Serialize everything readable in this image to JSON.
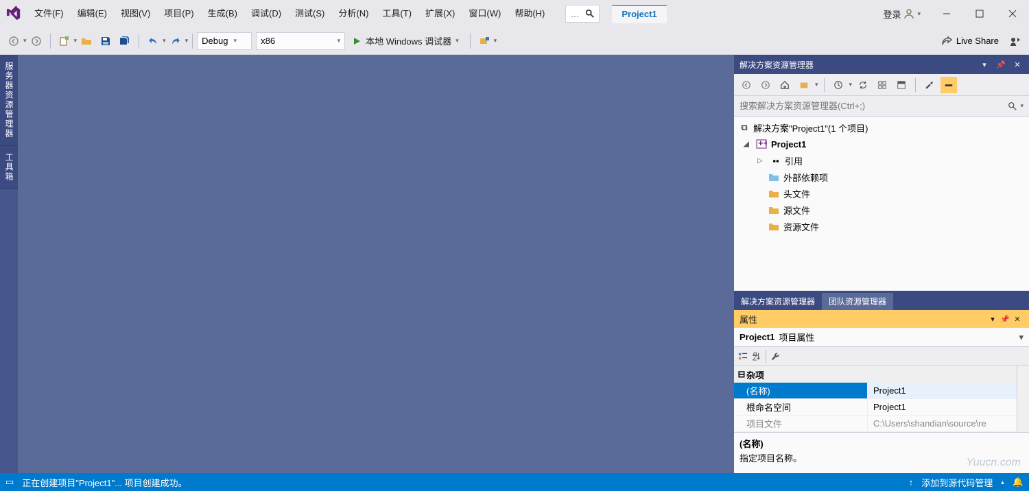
{
  "menu": {
    "file": "文件(F)",
    "edit": "编辑(E)",
    "view": "视图(V)",
    "project": "项目(P)",
    "build": "生成(B)",
    "debug": "调试(D)",
    "test": "测试(S)",
    "analyze": "分析(N)",
    "tools": "工具(T)",
    "extensions": "扩展(X)",
    "window": "窗口(W)",
    "help": "帮助(H)"
  },
  "title": {
    "project_tab": "Project1",
    "login": "登录"
  },
  "toolbar": {
    "config": "Debug",
    "platform": "x86",
    "run": "本地 Windows 调试器",
    "liveshare": "Live Share"
  },
  "left_tabs": {
    "server_explorer": "服务器资源管理器",
    "toolbox": "工具箱"
  },
  "solution_explorer": {
    "title": "解决方案资源管理器",
    "search_placeholder": "搜索解决方案资源管理器(Ctrl+;)",
    "root": "解决方案\"Project1\"(1 个项目)",
    "project": "Project1",
    "refs": "引用",
    "external": "外部依赖项",
    "headers": "头文件",
    "sources": "源文件",
    "resources": "资源文件",
    "tab_solution": "解决方案资源管理器",
    "tab_team": "团队资源管理器"
  },
  "properties": {
    "title": "属性",
    "subject_name": "Project1",
    "subject_type": "项目属性",
    "category": "杂项",
    "rows": {
      "name_key": "(名称)",
      "name_val": "Project1",
      "root_key": "根命名空间",
      "root_val": "Project1",
      "file_key": "项目文件",
      "file_val": "C:\\Users\\shandian\\source\\re"
    },
    "desc_title": "(名称)",
    "desc_text": "指定项目名称。"
  },
  "status": {
    "message": "正在创建项目\"Project1\"...  项目创建成功。",
    "scm": "添加到源代码管理"
  },
  "watermark": "Yuucn.com"
}
